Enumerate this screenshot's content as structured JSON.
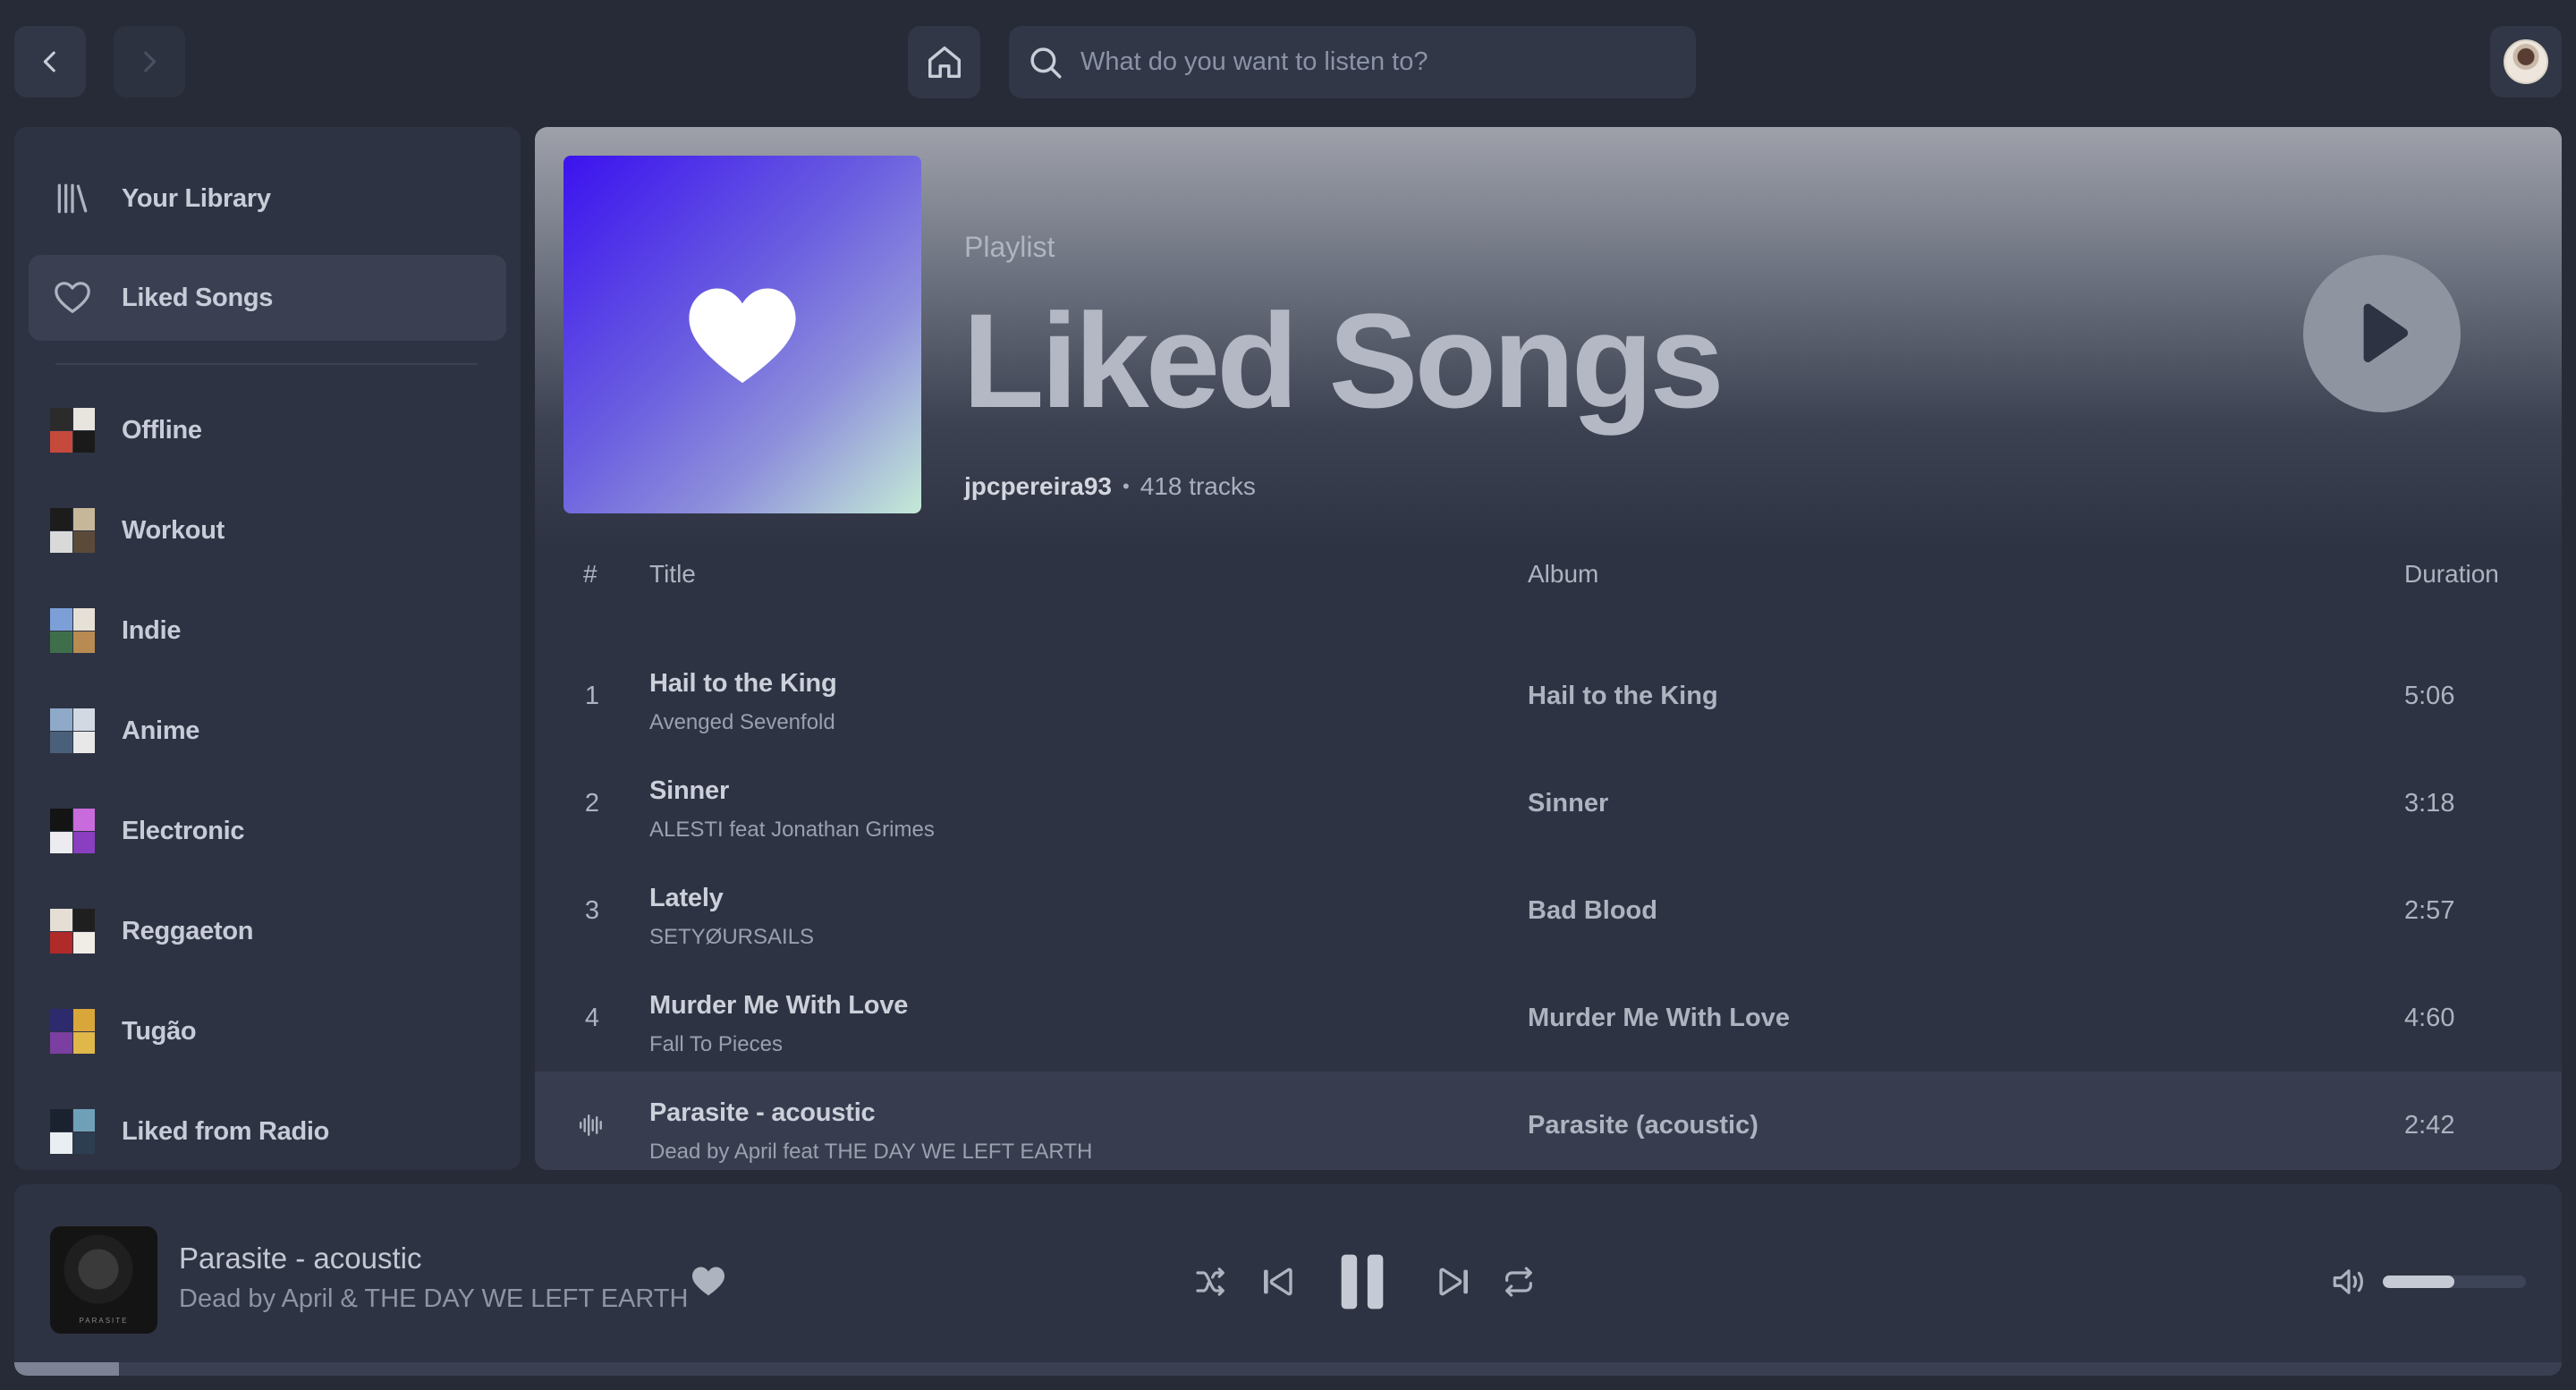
{
  "topbar": {
    "back_icon": "chevron-left-icon",
    "forward_icon": "chevron-right-icon",
    "home_icon": "home-icon",
    "search_placeholder": "What do you want to listen to?",
    "search_value": ""
  },
  "sidebar": {
    "nav": [
      {
        "label": "Your Library",
        "icon": "library-icon"
      },
      {
        "label": "Liked Songs",
        "icon": "heart-outline-icon",
        "active": true
      }
    ],
    "playlists": [
      {
        "label": "Offline",
        "colors": [
          "#2b2b2b",
          "#e8e4de",
          "#c64a3b",
          "#1a1a1a"
        ]
      },
      {
        "label": "Workout",
        "colors": [
          "#1c1c1c",
          "#c7b79a",
          "#d9d9d9",
          "#5b4a3a"
        ]
      },
      {
        "label": "Indie",
        "colors": [
          "#7c9fd8",
          "#e6e0d6",
          "#3f6f4a",
          "#b88b52"
        ]
      },
      {
        "label": "Anime",
        "colors": [
          "#8fa9c8",
          "#d3d9e3",
          "#4a5f7a",
          "#e8e8e8"
        ]
      },
      {
        "label": "Electronic",
        "colors": [
          "#141414",
          "#c86bdc",
          "#ecebf0",
          "#8a3fc0"
        ]
      },
      {
        "label": "Reggaeton",
        "colors": [
          "#e4ded5",
          "#1f1f1f",
          "#b02a2a",
          "#f0ece6"
        ]
      },
      {
        "label": "Tugão",
        "colors": [
          "#2d2a6e",
          "#d9a63a",
          "#7a3fa0",
          "#e0b84a"
        ]
      },
      {
        "label": "Liked from Radio",
        "colors": [
          "#1a2230",
          "#6fa0b8",
          "#e9eef2",
          "#2c3e50"
        ]
      }
    ]
  },
  "playlist": {
    "type_label": "Playlist",
    "title": "Liked Songs",
    "owner": "jpcpereira93",
    "separator": "•",
    "track_count": "418 tracks",
    "cover_icon": "heart-icon",
    "play_icon": "play-icon"
  },
  "table": {
    "headers": {
      "num": "#",
      "title": "Title",
      "album": "Album",
      "duration": "Duration"
    },
    "rows": [
      {
        "num": "1",
        "title": "Hail to the King",
        "artist": "Avenged Sevenfold",
        "album": "Hail to the King",
        "duration": "5:06"
      },
      {
        "num": "2",
        "title": "Sinner",
        "artist": "ALESTI feat Jonathan Grimes",
        "album": "Sinner",
        "duration": "3:18"
      },
      {
        "num": "3",
        "title": "Lately",
        "artist": "SETYØURSAILS",
        "album": "Bad Blood",
        "duration": "2:57"
      },
      {
        "num": "4",
        "title": "Murder Me With Love",
        "artist": "Fall To Pieces",
        "album": "Murder Me With Love",
        "duration": "4:60"
      },
      {
        "num": "",
        "title": "Parasite - acoustic",
        "artist": "Dead by April feat THE DAY WE LEFT EARTH",
        "album": "Parasite (acoustic)",
        "duration": "2:42",
        "playing": true,
        "playing_icon": "equalizer-icon"
      }
    ]
  },
  "player": {
    "title": "Parasite - acoustic",
    "artist": "Dead by April & THE DAY WE LEFT EARTH",
    "art_caption": "PARASITE",
    "liked": true,
    "controls": [
      "shuffle-icon",
      "previous-icon",
      "pause-icon",
      "next-icon",
      "repeat-icon"
    ],
    "volume_icon": "volume-icon",
    "volume_level": 0.5,
    "progress": 0.041
  }
}
